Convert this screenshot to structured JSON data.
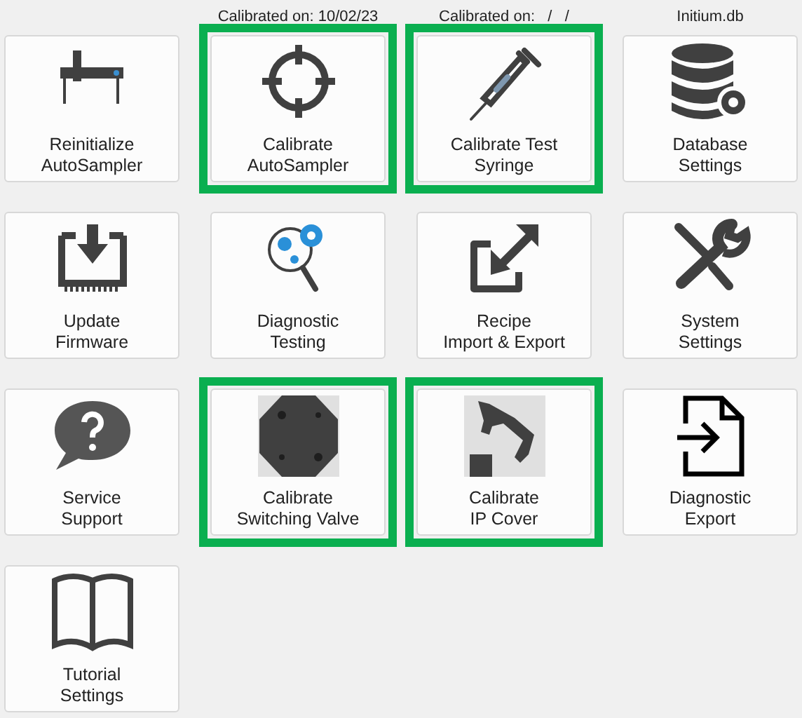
{
  "tiles": [
    {
      "label": [
        "Reinitialize",
        "AutoSampler"
      ],
      "highlighted": false
    },
    {
      "label": [
        "Calibrate",
        "AutoSampler"
      ],
      "highlighted": true,
      "caption": "Calibrated on: 10/02/23"
    },
    {
      "label": [
        "Calibrate Test",
        "Syringe"
      ],
      "highlighted": true,
      "caption": "Calibrated on:   /   /"
    },
    {
      "label": [
        "Database",
        "Settings"
      ],
      "highlighted": false,
      "caption": "Initium.db"
    },
    {
      "label": [
        "Update",
        "Firmware"
      ],
      "highlighted": false
    },
    {
      "label": [
        "Diagnostic",
        "Testing"
      ],
      "highlighted": false
    },
    {
      "label": [
        "Recipe",
        "Import & Export"
      ],
      "highlighted": false
    },
    {
      "label": [
        "System",
        "Settings"
      ],
      "highlighted": false
    },
    {
      "label": [
        "Service",
        "Support"
      ],
      "highlighted": false
    },
    {
      "label": [
        "Calibrate",
        "Switching Valve"
      ],
      "highlighted": true
    },
    {
      "label": [
        "Calibrate",
        "IP Cover"
      ],
      "highlighted": true
    },
    {
      "label": [
        "Diagnostic",
        "Export"
      ],
      "highlighted": false
    },
    {
      "label": [
        "Tutorial",
        "Settings"
      ],
      "highlighted": false
    }
  ]
}
